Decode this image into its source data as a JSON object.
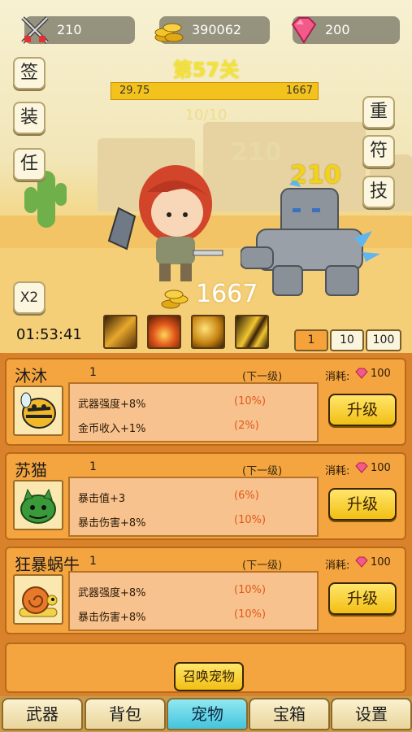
{
  "resources": {
    "attack": "210",
    "gold": "390062",
    "gems": "200"
  },
  "side_left": [
    "签",
    "装",
    "任"
  ],
  "side_right": [
    "重",
    "符",
    "技"
  ],
  "speed_button": "X2",
  "battle": {
    "level_title": "第57关",
    "hp_left": "29.75",
    "hp_right": "1667",
    "hp_fraction": 0.018,
    "wave": "10/10",
    "damage_faded": "210",
    "damage_hit": "210",
    "coin_drop": "1667",
    "timer": "01:53:41"
  },
  "skills": [
    "slash-skill-icon",
    "fire-skill-icon",
    "gold-skill-icon",
    "lightning-skill-icon"
  ],
  "multipliers": {
    "options": [
      "1",
      "10",
      "100"
    ],
    "active": "1"
  },
  "pets": [
    {
      "name": "沐沐",
      "level": "1",
      "next_label": "(下一级)",
      "cost_label": "消耗:",
      "cost": "100",
      "upgrade": "升级",
      "icon": "bee-pet-icon",
      "stats": [
        {
          "label": "武器强度+8%",
          "next": "(10%)"
        },
        {
          "label": "金币收入+1%",
          "next": "(2%)"
        }
      ]
    },
    {
      "name": "苏猫",
      "level": "1",
      "next_label": "(下一级)",
      "cost_label": "消耗:",
      "cost": "100",
      "upgrade": "升级",
      "icon": "green-cat-pet-icon",
      "stats": [
        {
          "label": "暴击值+3",
          "next": "(6%)"
        },
        {
          "label": "暴击伤害+8%",
          "next": "(10%)"
        }
      ]
    },
    {
      "name": "狂暴蜗牛",
      "level": "1",
      "next_label": "(下一级)",
      "cost_label": "消耗:",
      "cost": "100",
      "upgrade": "升级",
      "icon": "snail-pet-icon",
      "stats": [
        {
          "label": "武器强度+8%",
          "next": "(10%)"
        },
        {
          "label": "暴击伤害+8%",
          "next": "(10%)"
        }
      ]
    }
  ],
  "summon_button": "召唤宠物",
  "nav": {
    "tabs": [
      "武器",
      "背包",
      "宠物",
      "宝箱",
      "设置"
    ],
    "active": "宠物"
  },
  "colors": {
    "panel": "#d9822b",
    "card": "#f4a53f",
    "button_gold": "#f2bf14",
    "active_tab": "#45c4dc",
    "hp_bar": "#f4c21d",
    "level_title": "#f2e23a"
  }
}
